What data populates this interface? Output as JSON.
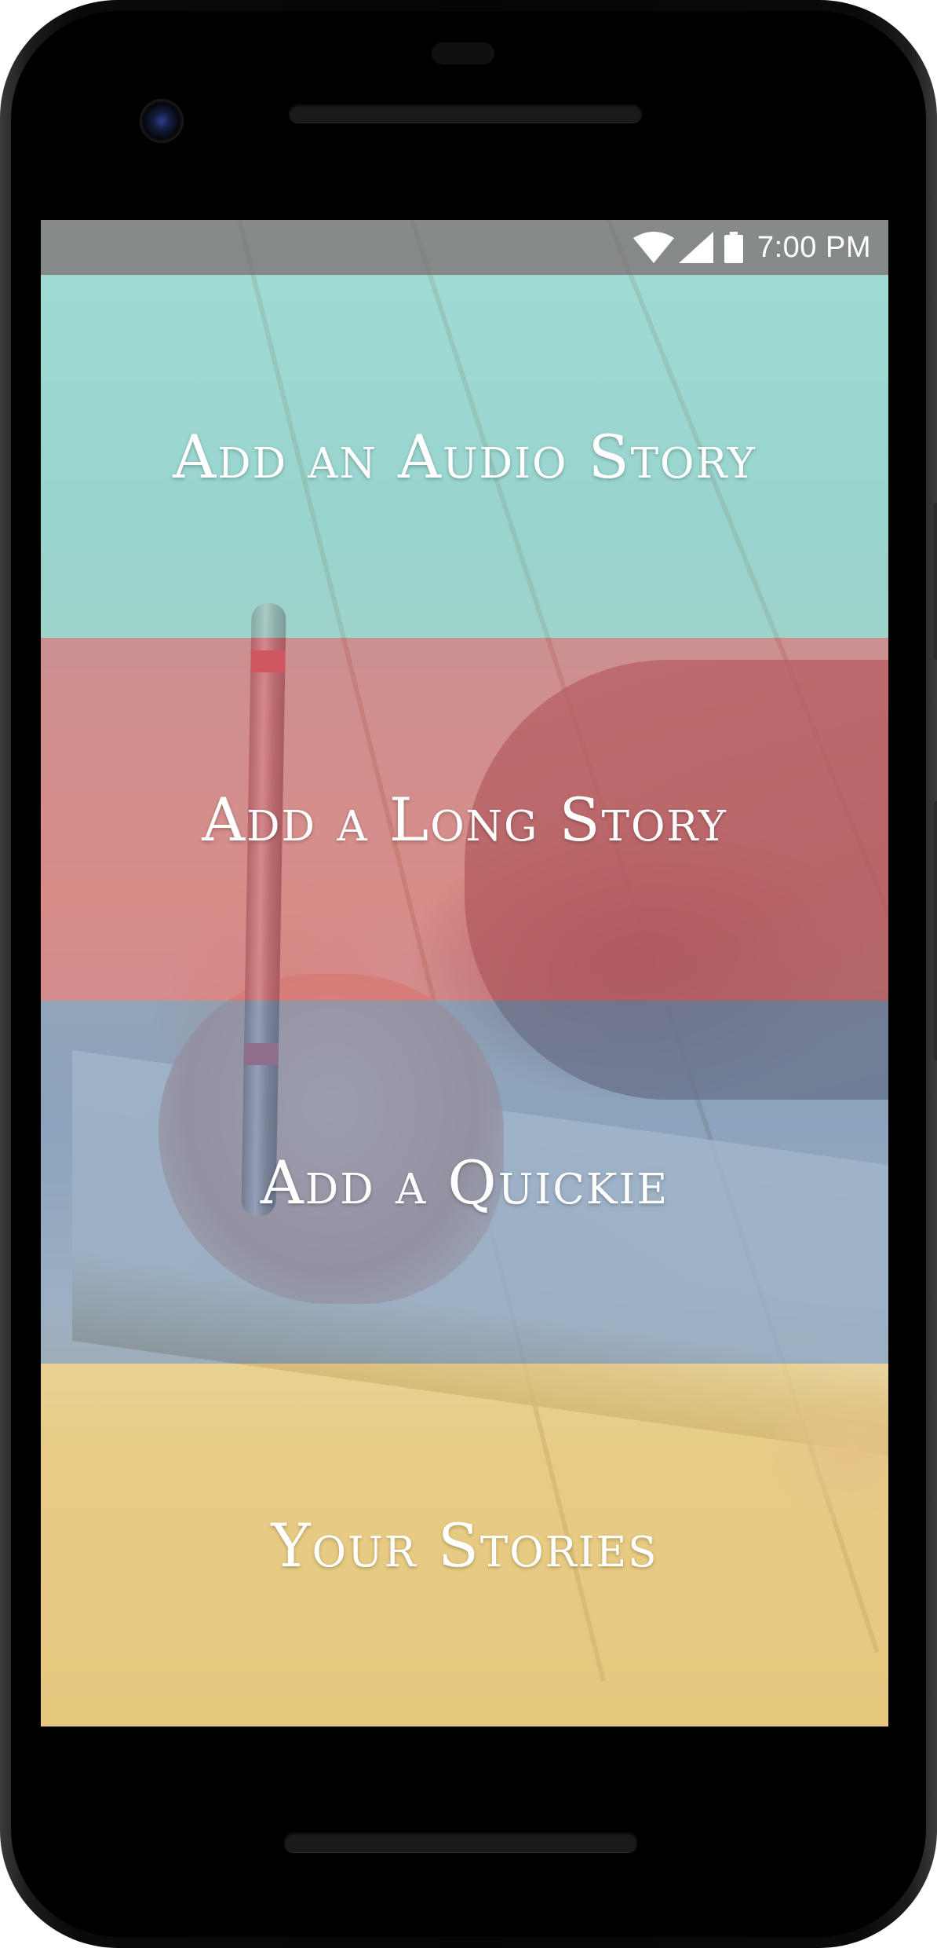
{
  "status_bar": {
    "time": "7:00 PM",
    "icons": [
      "wifi-icon",
      "signal-icon",
      "battery-icon"
    ]
  },
  "menu": {
    "items": [
      {
        "label": "Add an Audio Story",
        "overlay_color": "#8fd6cf"
      },
      {
        "label": "Add a Long Story",
        "overlay_color": "#d96b70"
      },
      {
        "label": "Add a Quickie",
        "overlay_color": "#6f8fb3"
      },
      {
        "label": "Your Stories",
        "overlay_color": "#e8c977"
      }
    ]
  }
}
